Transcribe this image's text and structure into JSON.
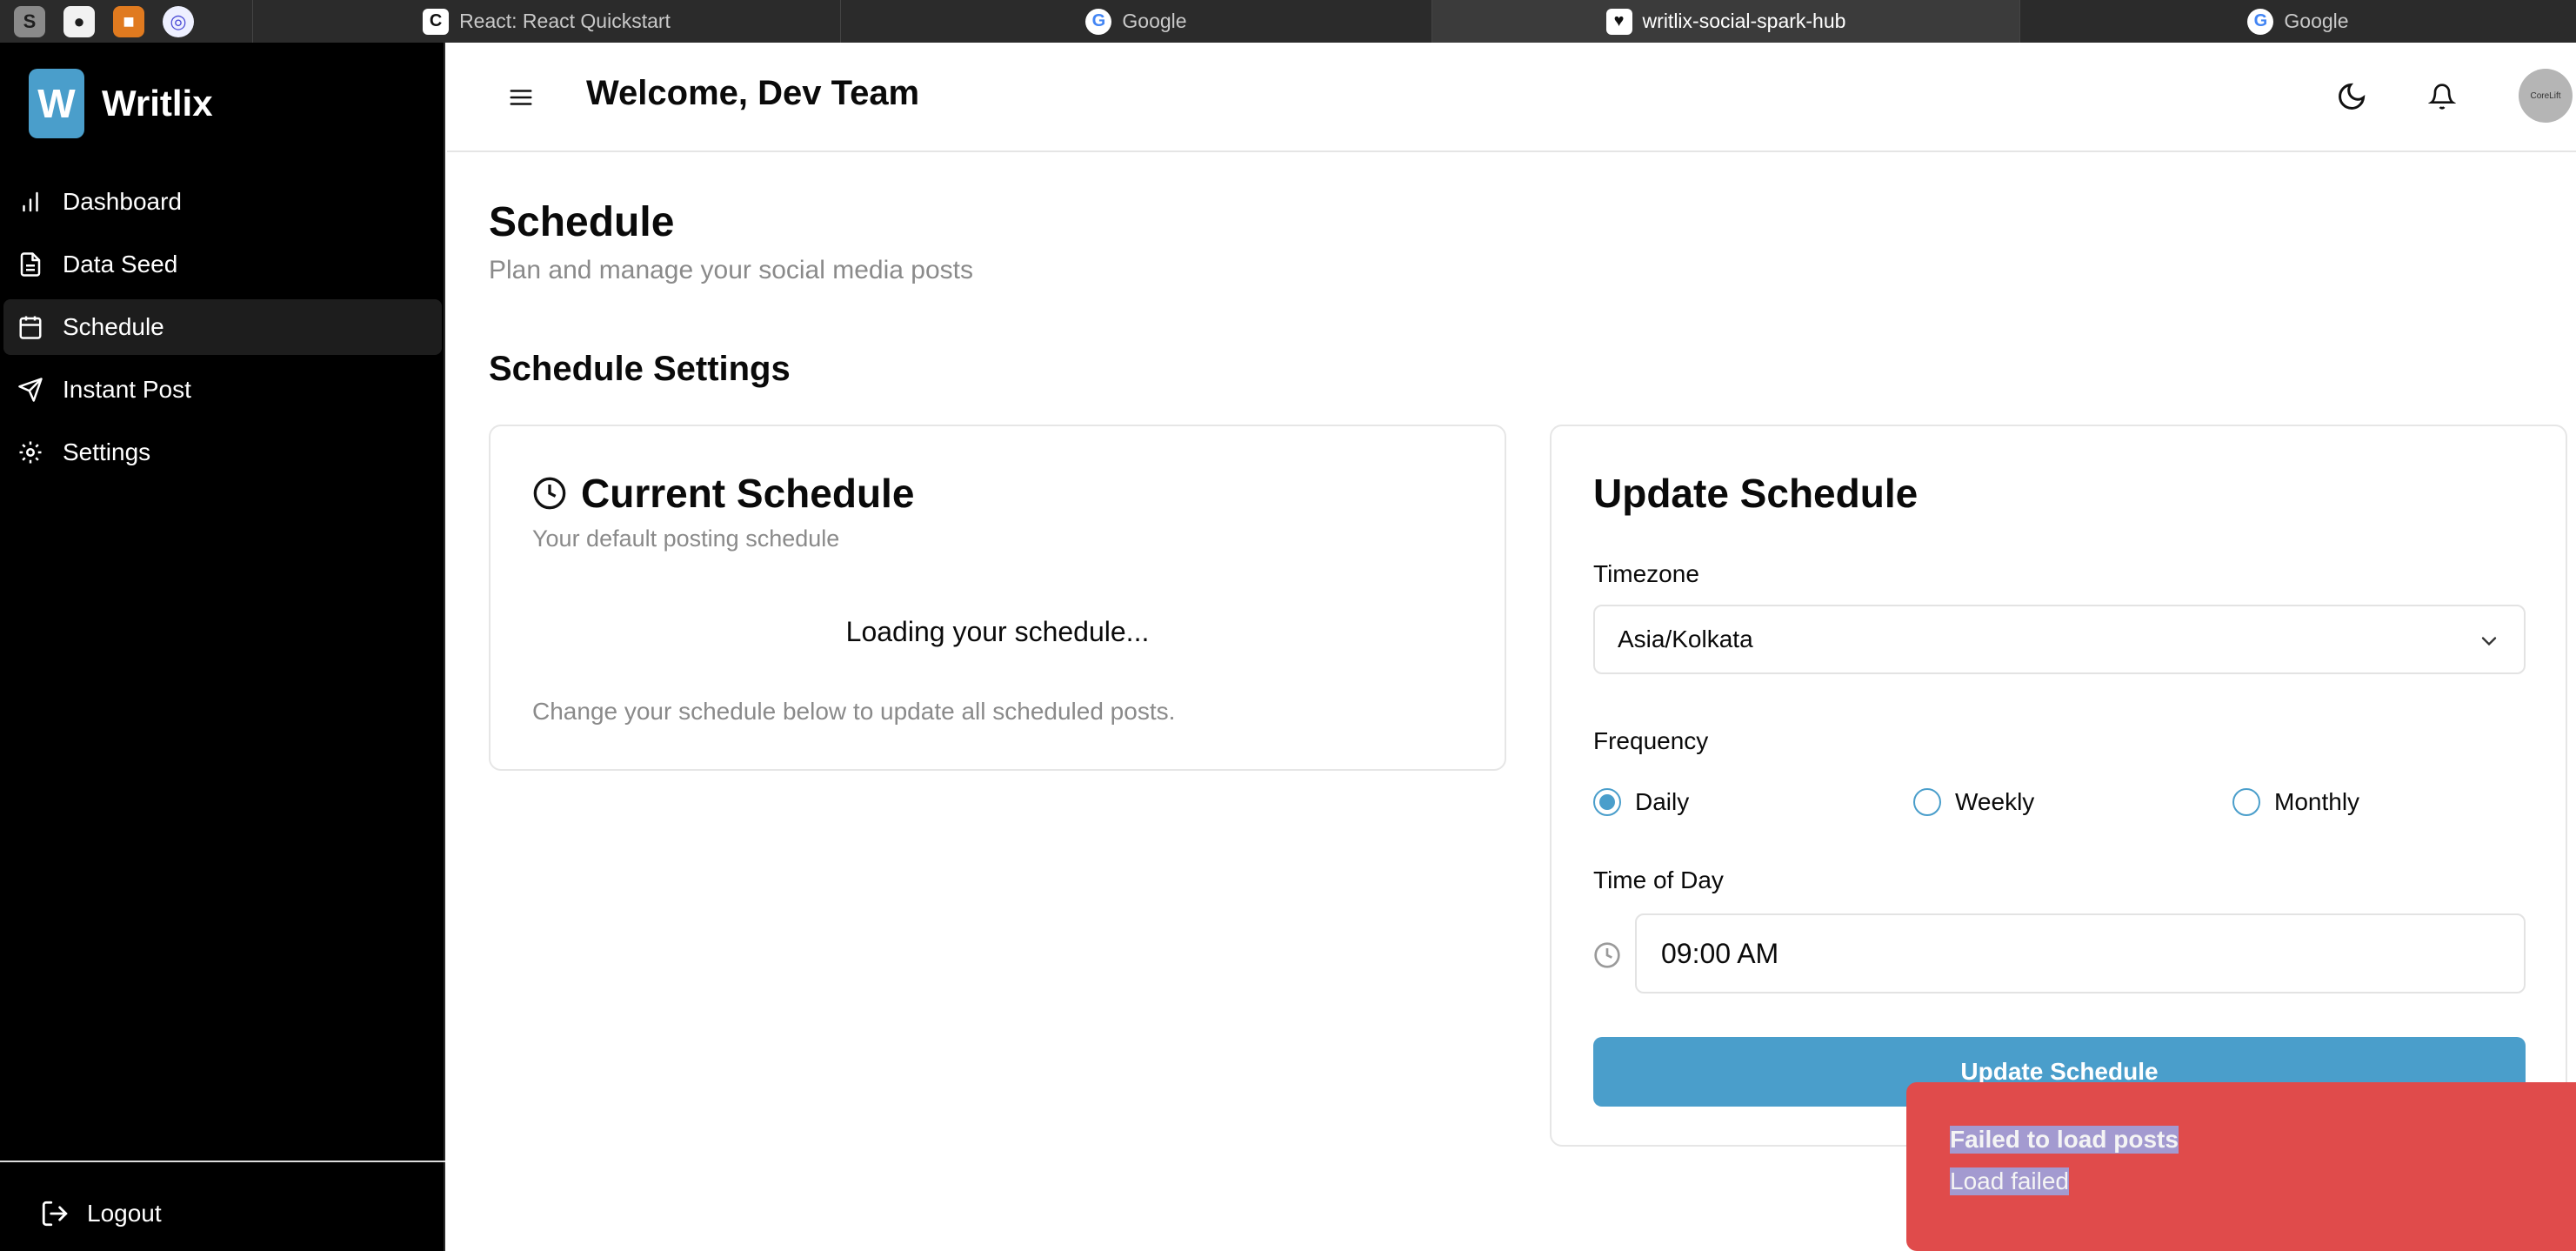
{
  "browser": {
    "pinned": [
      "S",
      "GH",
      "box",
      "ring"
    ],
    "tabs": [
      {
        "title": "React: React Quickstart",
        "icon": "react-icon"
      },
      {
        "title": "Google",
        "icon": "google-icon"
      },
      {
        "title": "writlix-social-spark-hub",
        "icon": "heart-icon"
      },
      {
        "title": "Google",
        "icon": "google-icon"
      }
    ]
  },
  "sidebar": {
    "logo_letter": "W",
    "brand": "Writlix",
    "items": [
      {
        "label": "Dashboard"
      },
      {
        "label": "Data Seed"
      },
      {
        "label": "Schedule"
      },
      {
        "label": "Instant Post"
      },
      {
        "label": "Settings"
      }
    ],
    "logout": "Logout"
  },
  "header": {
    "welcome": "Welcome, Dev Team",
    "avatar_text": "CoreLift"
  },
  "page": {
    "title": "Schedule",
    "subtitle": "Plan and manage your social media posts",
    "section": "Schedule Settings"
  },
  "current_schedule": {
    "title": "Current Schedule",
    "subtitle": "Your default posting schedule",
    "loading": "Loading your schedule...",
    "note": "Change your schedule below to update all scheduled posts."
  },
  "update_schedule": {
    "title": "Update Schedule",
    "timezone_label": "Timezone",
    "timezone_value": "Asia/Kolkata",
    "frequency_label": "Frequency",
    "frequency_options": [
      "Daily",
      "Weekly",
      "Monthly"
    ],
    "frequency_selected": "Daily",
    "time_label": "Time of Day",
    "time_value": "09:00 AM",
    "button": "Update Schedule"
  },
  "toast": {
    "title": "Failed to load posts",
    "message": "Load failed"
  },
  "colors": {
    "accent": "#4a9ecb",
    "sidebar_bg": "#000000",
    "toast_bg": "#e04b4b"
  }
}
